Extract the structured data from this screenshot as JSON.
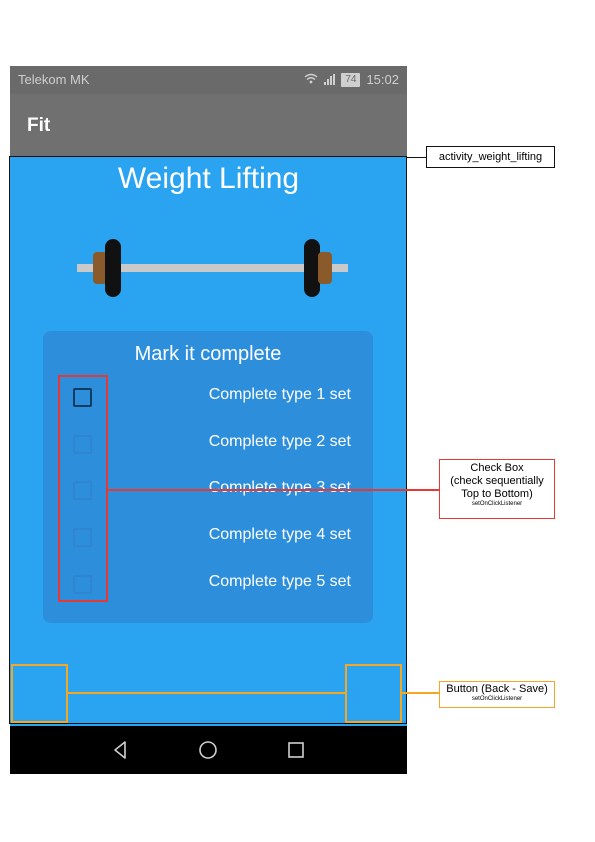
{
  "status_bar": {
    "carrier": "Telekom MK",
    "battery": "74",
    "time": "15:02"
  },
  "app_bar": {
    "title": "Fit"
  },
  "screen": {
    "heading": "Weight Lifting",
    "card_title": "Mark it complete",
    "sets": [
      {
        "label": "Complete type 1 set",
        "checked": false
      },
      {
        "label": "Complete type 2 set",
        "checked": false
      },
      {
        "label": "Complete type 3 set",
        "checked": false
      },
      {
        "label": "Complete type 4 set",
        "checked": false
      },
      {
        "label": "Complete type 5 set",
        "checked": false
      }
    ],
    "back_icon": "arrow-left-icon",
    "save_icon": "check-mark-icon"
  },
  "nav_bar": {
    "icons": [
      "back-triangle-icon",
      "home-circle-icon",
      "recents-square-icon"
    ]
  },
  "annotations": {
    "activity": {
      "text": "activity_weight_lifting",
      "color": "#000000"
    },
    "checkbox": {
      "line1": "Check Box",
      "line2": "(check sequentially",
      "line3": "Top to Bottom)",
      "line4": "setOnClickListener",
      "color": "#e53935"
    },
    "buttons": {
      "line1": "Button (Back - Save)",
      "line2": "setOnClickListener",
      "color": "#f5a623"
    }
  },
  "colors": {
    "status_bar": "#6a6a6a",
    "app_bar": "#707070",
    "content_bg": "#2aa3f1",
    "card_bg": "#2d8fdb",
    "save_check": "#e53935",
    "nav_bar": "#000000"
  }
}
